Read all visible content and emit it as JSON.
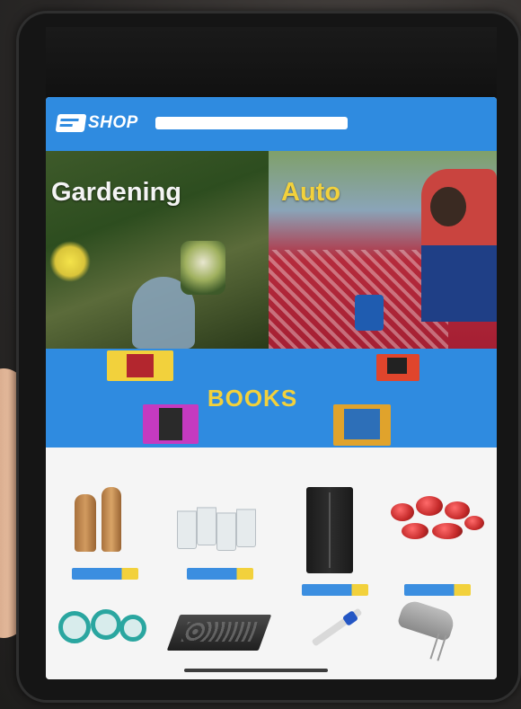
{
  "header": {
    "logo_text": "SHOP",
    "search_placeholder": ""
  },
  "categories": [
    {
      "label": "Gardening"
    },
    {
      "label": "Auto"
    }
  ],
  "books_banner": {
    "label": "BOOKS"
  },
  "products": [
    {
      "name": "wooden-salt-pepper-mills",
      "caption": "",
      "button": ""
    },
    {
      "name": "glass-tumblers",
      "caption": "",
      "button": ""
    },
    {
      "name": "black-refrigerator",
      "caption": "",
      "button": ""
    },
    {
      "name": "red-cookware-set",
      "caption": "",
      "button": ""
    },
    {
      "name": "teal-dinnerware-set",
      "caption": "",
      "button": ""
    },
    {
      "name": "gas-cooktop",
      "caption": "",
      "button": ""
    },
    {
      "name": "hand-blender",
      "caption": "",
      "button": ""
    },
    {
      "name": "hand-mixer",
      "caption": "",
      "button": ""
    }
  ],
  "colors": {
    "brand_blue": "#2f8be0",
    "accent_yellow": "#f2d13c",
    "page_bg": "#f5f5f5"
  }
}
